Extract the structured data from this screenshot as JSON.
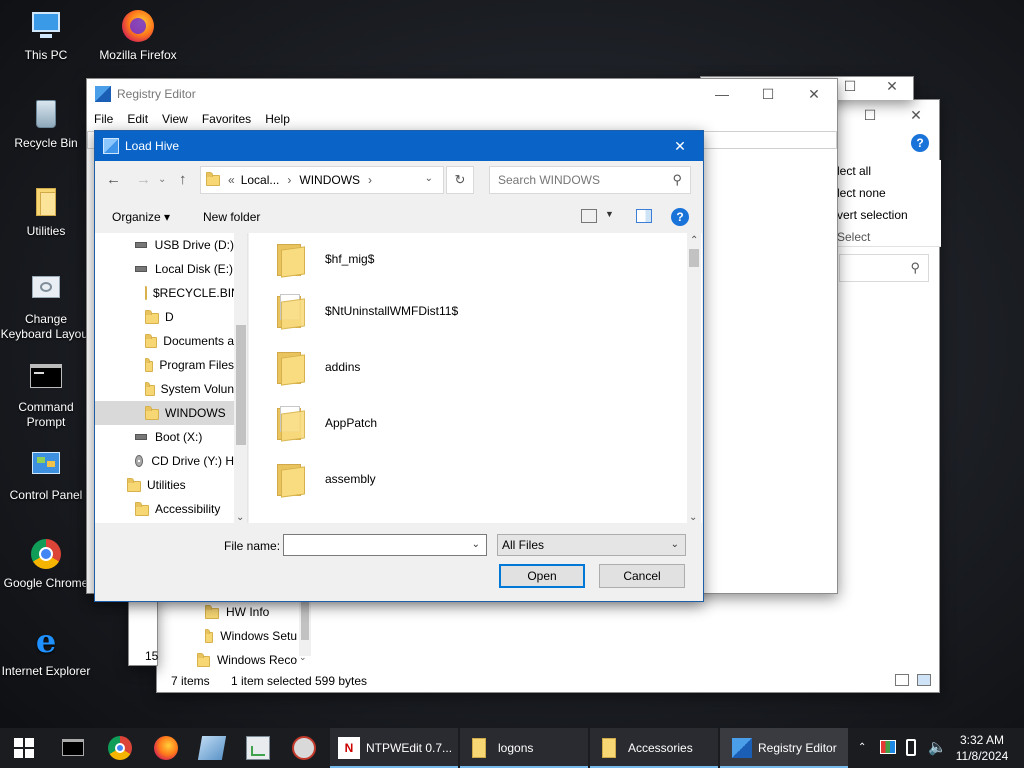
{
  "desktop": {
    "icons": [
      {
        "label": "This PC",
        "icon": "this-pc-icon"
      },
      {
        "label": "Mozilla Firefox",
        "icon": "firefox-icon"
      },
      {
        "label": "Recycle Bin",
        "icon": "recycle-bin-icon"
      },
      {
        "label": "Utilities",
        "icon": "folder-icon"
      },
      {
        "label": "Change\nKeyboard Layout",
        "icon": "keyboard-layout-icon"
      },
      {
        "label": "Command\nPrompt",
        "icon": "command-prompt-icon"
      },
      {
        "label": "Control Panel",
        "icon": "control-panel-icon"
      },
      {
        "label": "Google Chrome",
        "icon": "chrome-icon"
      },
      {
        "label": "Internet Explorer",
        "icon": "internet-explorer-icon"
      }
    ]
  },
  "back_explorer": {
    "ribbon": [
      "lect all",
      "lect none",
      "vert selection",
      "Select"
    ],
    "tree": [
      "HW Info",
      "Windows Setu",
      "Windows Reco"
    ],
    "left_fragment": "15",
    "status": {
      "items": "7 items",
      "selected": "1 item selected",
      "size": "599 bytes"
    }
  },
  "registry_editor": {
    "title": "Registry Editor",
    "menu": [
      "File",
      "Edit",
      "View",
      "Favorites",
      "Help"
    ]
  },
  "dialog": {
    "title": "Load Hive",
    "breadcrumb": {
      "prefix": "«",
      "part1": "Local...",
      "sep": "›",
      "part2": "WINDOWS"
    },
    "search_placeholder": "Search WINDOWS",
    "toolbar": {
      "organize": "Organize ▾",
      "new_folder": "New folder",
      "help": "?"
    },
    "tree": [
      {
        "label": "USB Drive (D:)",
        "kind": "drive"
      },
      {
        "label": "Local Disk (E:)",
        "kind": "drive"
      },
      {
        "label": "$RECYCLE.BIN",
        "kind": "folder"
      },
      {
        "label": "D",
        "kind": "folder"
      },
      {
        "label": "Documents a",
        "kind": "folder"
      },
      {
        "label": "Program Files",
        "kind": "folder"
      },
      {
        "label": "System Volun",
        "kind": "folder"
      },
      {
        "label": "WINDOWS",
        "kind": "folder",
        "selected": true
      },
      {
        "label": "Boot (X:)",
        "kind": "drive"
      },
      {
        "label": "CD Drive (Y:) H",
        "kind": "cd"
      },
      {
        "label": "Utilities",
        "kind": "folder"
      },
      {
        "label": "Accessibility",
        "kind": "folder"
      }
    ],
    "files": [
      {
        "name": "$hf_mig$",
        "kind": "folder"
      },
      {
        "name": "$NtUninstallWMFDist11$",
        "kind": "folder-docs"
      },
      {
        "name": "addins",
        "kind": "folder"
      },
      {
        "name": "AppPatch",
        "kind": "folder-docs"
      },
      {
        "name": "assembly",
        "kind": "folder"
      }
    ],
    "filename_label": "File name:",
    "filename_value": "",
    "filetype": "All Files",
    "open_label": "Open",
    "cancel_label": "Cancel"
  },
  "taskbar": {
    "apps": [
      {
        "label": "NTPWEdit 0.7...",
        "icon": "ntpwedit-icon"
      },
      {
        "label": "logons",
        "icon": "folder-icon"
      },
      {
        "label": "Accessories",
        "icon": "folder-icon"
      },
      {
        "label": "Registry Editor",
        "icon": "registry-editor-icon",
        "active": true
      }
    ],
    "time": "3:32 AM",
    "date": "11/8/2024"
  },
  "colors": {
    "accent": "#0a64c8",
    "selection": "#cce8ff",
    "folder": "#f7d774"
  }
}
